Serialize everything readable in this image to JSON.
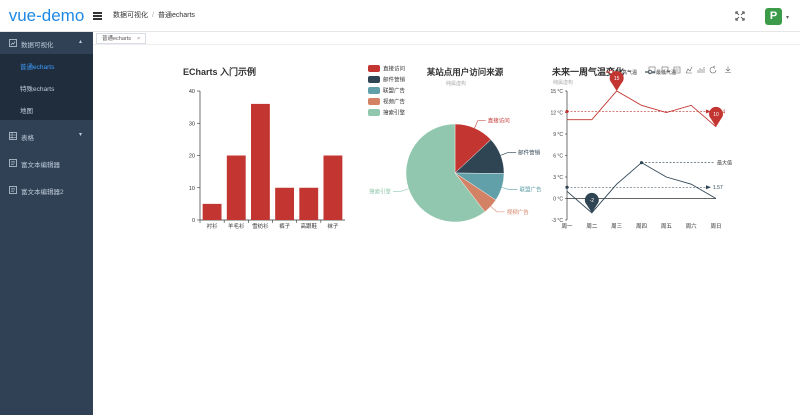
{
  "header": {
    "logo": "vue-demo",
    "breadcrumb": [
      "数据可视化",
      "普通echarts"
    ],
    "avatar_letter": "P"
  },
  "sidebar": {
    "items": [
      {
        "label": "数据可视化",
        "icon": "chart-icon",
        "arrow": "▴"
      },
      {
        "label": "普通echarts",
        "active": true
      },
      {
        "label": "特殊echarts"
      },
      {
        "label": "地图"
      },
      {
        "label": "表格",
        "icon": "table-icon",
        "arrow": "▾"
      },
      {
        "label": "富文本编辑器",
        "icon": "editor-icon"
      },
      {
        "label": "富文本编辑器2",
        "icon": "editor-icon"
      }
    ]
  },
  "tabs": [
    {
      "label": "普通echarts",
      "close": "×"
    }
  ],
  "colors": {
    "sidebar_bg": "#304156",
    "accent": "#409eff",
    "bar": "#c23531",
    "pie": [
      "#c23531",
      "#2f4554",
      "#61a0a8",
      "#d48265",
      "#91c7ae"
    ]
  },
  "chart_data": [
    {
      "type": "bar",
      "title": "ECharts 入门示例",
      "categories": [
        "衬衫",
        "羊毛衫",
        "雪纺衫",
        "裤子",
        "高跟鞋",
        "袜子"
      ],
      "values": [
        5,
        20,
        36,
        10,
        10,
        20
      ],
      "ylim": [
        0,
        40
      ],
      "yticks": [
        0,
        10,
        20,
        30,
        40
      ],
      "grid": false
    },
    {
      "type": "pie",
      "title": "某站点用户访问来源",
      "subtitle": "纯属虚构",
      "legend_position": "top-left",
      "slices": [
        {
          "name": "直接访问",
          "value": 335
        },
        {
          "name": "邮件营销",
          "value": 310
        },
        {
          "name": "联盟广告",
          "value": 234
        },
        {
          "name": "视频广告",
          "value": 135
        },
        {
          "name": "搜索引擎",
          "value": 1548
        }
      ]
    },
    {
      "type": "line",
      "title": "未来一周气温变化",
      "subtitle": "纯属虚构",
      "categories": [
        "周一",
        "周二",
        "周三",
        "周四",
        "周五",
        "周六",
        "周日"
      ],
      "ylim": [
        -3,
        15
      ],
      "yticks": [
        -3,
        0,
        3,
        6,
        9,
        12,
        15
      ],
      "ytick_suffix": " °C",
      "series": [
        {
          "name": "最高气温",
          "values": [
            11,
            11,
            15,
            13,
            12,
            13,
            10
          ],
          "color": "#c23531",
          "max_pin": "15",
          "min_pin": "10",
          "avg_label": "11.14"
        },
        {
          "name": "最低气温",
          "values": [
            1,
            -2,
            2,
            5,
            3,
            2,
            0
          ],
          "color": "#2f4554",
          "min_pin": "-2",
          "max_line_label": "最大值",
          "avg_label": "1.57"
        }
      ]
    }
  ]
}
